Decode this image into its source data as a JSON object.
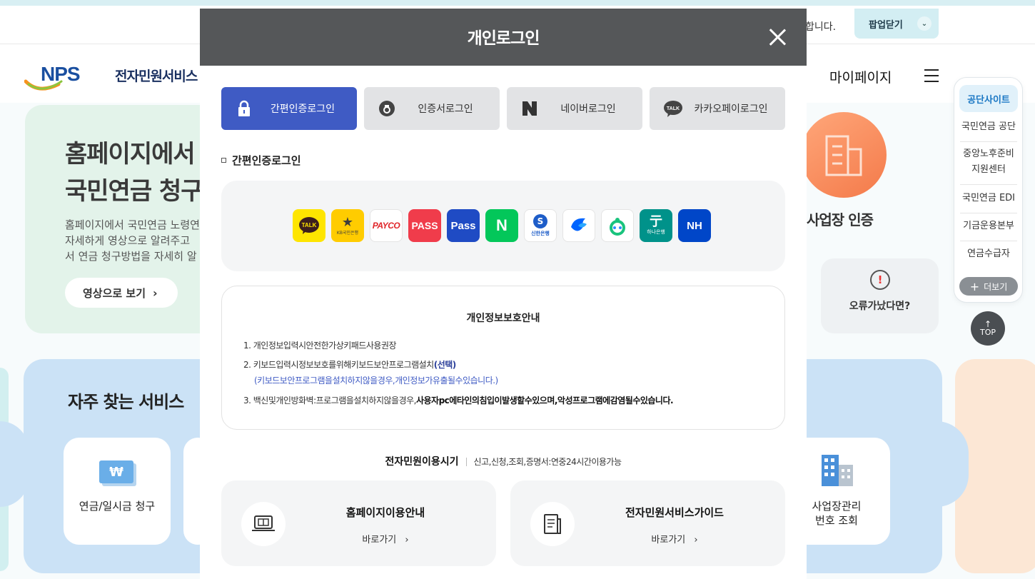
{
  "background": {
    "topbar_notice": "합니다.",
    "popup_close_label": "팝업닫기",
    "logo": {
      "brand": "NPS",
      "service": "전자민원서비스"
    },
    "mypage_label": "마이페이지",
    "hero": {
      "title": "홈페이지에서\n국민연금 청구",
      "desc": "홈페이지에서 국민연금 노령연\n자세하게 영상으로 알려주고 \n서 연금 청구방법을 자세히 알",
      "button": "영상으로 보기"
    },
    "frequent_title": "자주 찾는 서비스",
    "services": [
      {
        "label": "연금/일시금 청구",
        "icon": "won-icon"
      },
      {
        "label": "사업장관리\n번호 조회",
        "icon": "building-icon"
      }
    ],
    "business_cert": "사업장 인증",
    "error_card": "오류가났다면?",
    "quick_menu": {
      "head": "공단사이트",
      "items": [
        "국민연금 공단",
        "중앙노후준비\n지원센터",
        "국민연금 EDI",
        "기금운용본부",
        "연금수급자"
      ],
      "more": "더보기"
    },
    "top_button": "TOP"
  },
  "modal": {
    "title": "개인로그인",
    "tabs": [
      {
        "label": "간편인증로그인",
        "icon": "lock-icon",
        "active": true
      },
      {
        "label": "인증서로그인",
        "icon": "certificate-icon",
        "active": false
      },
      {
        "label": "네이버로그인",
        "icon": "naver-icon",
        "active": false
      },
      {
        "label": "카카오페이로그인",
        "icon": "kakao-talk-icon",
        "active": false
      }
    ],
    "section_title": "간편인증로그인",
    "providers": [
      {
        "name": "kakao",
        "text": "TALK"
      },
      {
        "name": "kb",
        "text": "KB국민은행"
      },
      {
        "name": "payco",
        "text": "PAYCO"
      },
      {
        "name": "pass-red",
        "text": "PASS"
      },
      {
        "name": "pass-blue",
        "text": "Pass"
      },
      {
        "name": "naver",
        "text": "N"
      },
      {
        "name": "shinhan",
        "text": "신한은행"
      },
      {
        "name": "toss",
        "text": ""
      },
      {
        "name": "banksalad",
        "text": ""
      },
      {
        "name": "hana",
        "text": "하나은행"
      },
      {
        "name": "nh",
        "text": "NH"
      }
    ],
    "privacy": {
      "title": "개인정보보호안내",
      "item1": "1. 개인정보입력시안전한가상키패드사용권장",
      "item2_prefix": "2. 키보드입력시정보보호를위해키보드보안프로그램설치",
      "item2_select": "(선택)",
      "item2_sub": "(키보드보안프로그램을설치하지않을경우,개인정보가유출될수있습니다.)",
      "item3_prefix": "3. 백신및개인방화벽:프로그램을설치하지않을경우,",
      "item3_bold": "사용자pc에타인의침입이발생할수있으며,악성프로그램에감염될수있습니다."
    },
    "hours": {
      "label": "전자민원이용시기",
      "text": "신고,신청,조회,증명서:연중24시간이용가능"
    },
    "guides": [
      {
        "title": "홈페이지이용안내",
        "link": "바로가기"
      },
      {
        "title": "전자민원서비스가이드",
        "link": "바로가기"
      }
    ]
  }
}
